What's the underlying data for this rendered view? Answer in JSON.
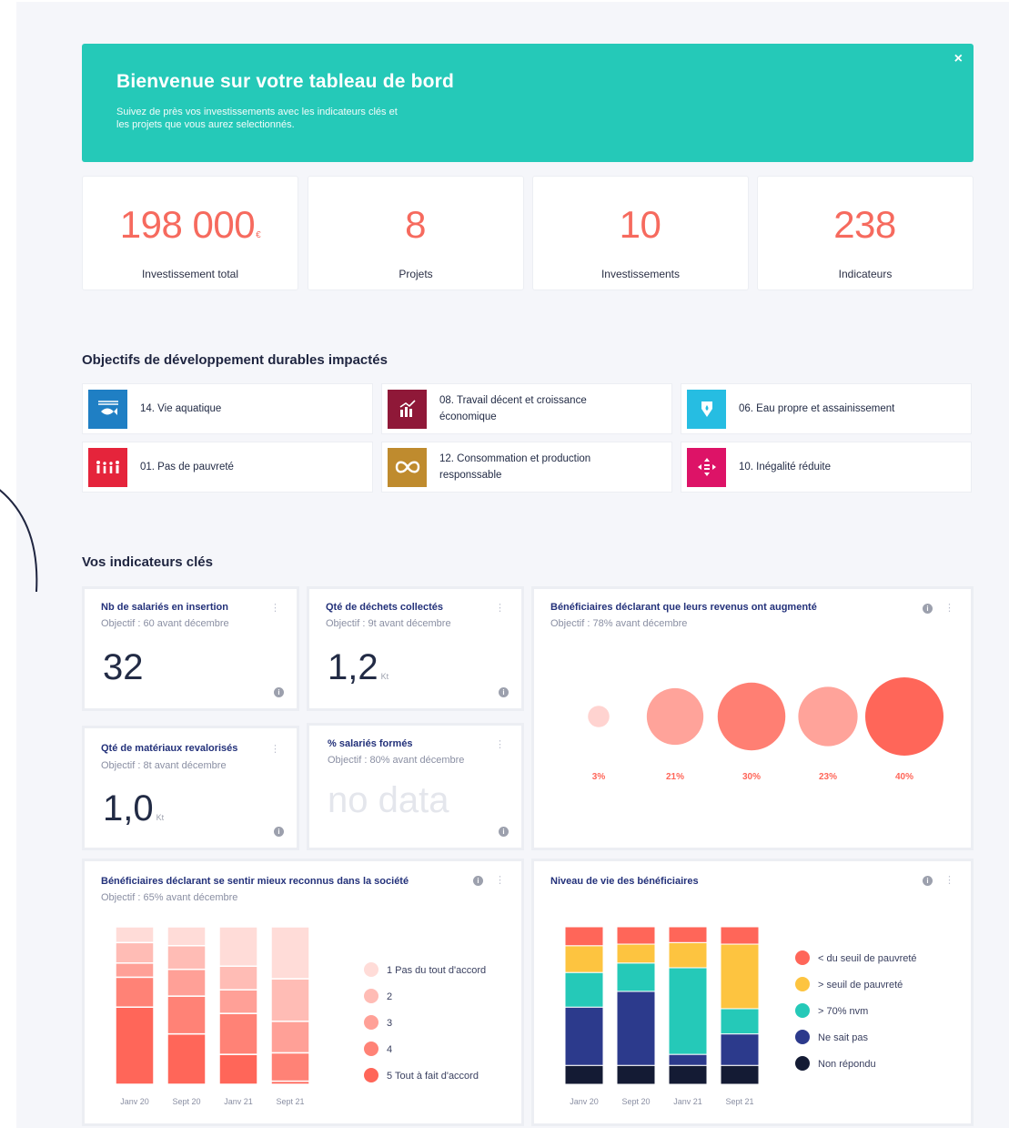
{
  "banner": {
    "title": "Bienvenue sur votre tableau de bord",
    "subtitle": "Suivez de près vos investissements avec les indicateurs clés et les projets que vous aurez selectionnés.",
    "close_label": "×"
  },
  "kpis": [
    {
      "value": "198 000",
      "unit": "€",
      "label": "Investissement total"
    },
    {
      "value": "8",
      "unit": "",
      "label": "Projets"
    },
    {
      "value": "10",
      "unit": "",
      "label": "Investissements"
    },
    {
      "value": "238",
      "unit": "",
      "label": "Indicateurs"
    }
  ],
  "sdg_section": {
    "title": "Objectifs de développement durables impactés",
    "items": [
      {
        "label": "14. Vie aquatique",
        "icon": "fish-icon",
        "color": "#1f7fc4"
      },
      {
        "label": "08. Travail décent et croissance économique",
        "icon": "growth-chart-icon",
        "color": "#8f1838"
      },
      {
        "label": "06. Eau propre et assainissement",
        "icon": "water-drop-icon",
        "color": "#26bde2"
      },
      {
        "label": "01. Pas de pauvreté",
        "icon": "people-family-icon",
        "color": "#e5243b"
      },
      {
        "label": "12. Consommation et production responssable",
        "icon": "infinity-icon",
        "color": "#bf8b2e"
      },
      {
        "label": "10. Inégalité réduite",
        "icon": "equality-arrows-icon",
        "color": "#dd1367"
      }
    ]
  },
  "indicators_section": {
    "title": "Vos indicateurs clés",
    "cards": [
      {
        "title": "Nb de salariés en insertion",
        "objective": "Objectif : 60 avant décembre",
        "value": "32",
        "unit": ""
      },
      {
        "title": "Qté de déchets collectés",
        "objective": "Objectif : 9t avant décembre",
        "value": "1,2",
        "unit": "Kt"
      },
      {
        "title": "Qté de matériaux revalorisés",
        "objective": "Objectif : 8t avant décembre",
        "value": "1,0",
        "unit": "Kt"
      },
      {
        "title": "% salariés formés",
        "objective": "Objectif : 80% avant décembre",
        "value": "no data",
        "unit": ""
      }
    ],
    "menu_glyph": "⋮",
    "info_glyph": "i"
  },
  "bubble_card": {
    "title": "Bénéficiaires déclarant que leurs revenus ont augmenté",
    "objective": "Objectif : 78% avant décembre"
  },
  "stack1_card": {
    "title": "Bénéficiaires déclarant se sentir mieux reconnus dans la société",
    "objective": "Objectif : 65% avant décembre"
  },
  "stack2_card": {
    "title": "Niveau de vie des bénéficiaires",
    "objective": ""
  },
  "chart_data": [
    {
      "type": "scatter",
      "title": "Bénéficiaires déclarant que leurs revenus ont augmenté",
      "values": [
        3,
        21,
        30,
        23,
        40
      ],
      "labels": [
        "3%",
        "21%",
        "30%",
        "23%",
        "40%"
      ],
      "colors": [
        "#ffd3d0",
        "#ffa39a",
        "#ff7f73",
        "#ffa39a",
        "#ff6659"
      ]
    },
    {
      "type": "bar",
      "stacked": true,
      "title": "Bénéficiaires déclarant se sentir mieux reconnus dans la société",
      "categories": [
        "Janv 20",
        "Sept 20",
        "Janv 21",
        "Sept 21"
      ],
      "series": [
        {
          "name": "5 Tout à fait d'accord",
          "color": "#ff6659",
          "values": [
            49,
            32,
            19,
            2
          ]
        },
        {
          "name": "4",
          "color": "#ff8276",
          "values": [
            19,
            24,
            26,
            18
          ]
        },
        {
          "name": "3",
          "color": "#ffa097",
          "values": [
            9,
            17,
            15,
            20
          ]
        },
        {
          "name": "2",
          "color": "#ffbcb5",
          "values": [
            13,
            15,
            15,
            27
          ]
        },
        {
          "name": "1 Pas du tout d'accord",
          "color": "#ffdcd8",
          "values": [
            10,
            12,
            25,
            33
          ]
        }
      ],
      "ylim": [
        0,
        100
      ]
    },
    {
      "type": "bar",
      "stacked": true,
      "title": "Niveau de vie des bénéficiaires",
      "categories": [
        "Janv 20",
        "Sept 20",
        "Janv 21",
        "Sept 21"
      ],
      "series": [
        {
          "name": "Non répondu",
          "color": "#141b34",
          "values": [
            12,
            12,
            12,
            12
          ]
        },
        {
          "name": "Ne sait pas",
          "color": "#2c3a8c",
          "values": [
            37,
            47,
            7,
            20
          ]
        },
        {
          "name": "> 70% nvm",
          "color": "#25c9b8",
          "values": [
            22,
            18,
            55,
            16
          ]
        },
        {
          "name": "> seuil de pauvreté",
          "color": "#fdc440",
          "values": [
            17,
            12,
            16,
            41
          ]
        },
        {
          "name": "< du seuil de pauvreté",
          "color": "#ff6659",
          "values": [
            12,
            11,
            10,
            11
          ]
        }
      ],
      "ylim": [
        0,
        100
      ]
    }
  ]
}
